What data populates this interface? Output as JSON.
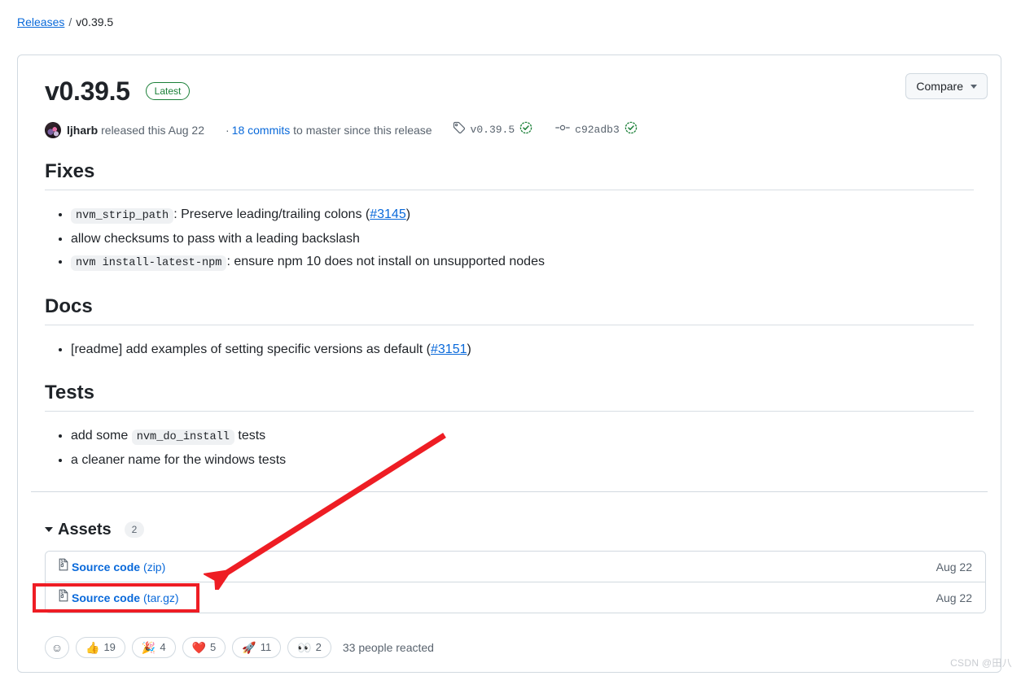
{
  "breadcrumb": {
    "root_label": "Releases",
    "separator": "/",
    "current_label": "v0.39.5"
  },
  "release": {
    "title": "v0.39.5",
    "latest_badge": "Latest",
    "compare_button": "Compare",
    "author": "ljharb",
    "released_text": "released this Aug 22",
    "commits_dot": "·",
    "commits_link": "18 commits",
    "commits_suffix": "to master since this release",
    "tag_name": "v0.39.5",
    "commit_sha": "c92adb3"
  },
  "notes": {
    "sections": [
      {
        "heading": "Fixes",
        "items": [
          {
            "code": "nvm_strip_path",
            "text": ": Preserve leading/trailing colons (",
            "link": "#3145",
            "tail": ")"
          },
          {
            "code": "",
            "text": "allow checksums to pass with a leading backslash",
            "link": "",
            "tail": ""
          },
          {
            "code": "nvm install-latest-npm",
            "text": ": ensure npm 10 does not install on unsupported nodes",
            "link": "",
            "tail": ""
          }
        ]
      },
      {
        "heading": "Docs",
        "items": [
          {
            "code": "",
            "text": "[readme] add examples of setting specific versions as default (",
            "link": "#3151",
            "tail": ")"
          }
        ]
      },
      {
        "heading": "Tests",
        "items": [
          {
            "code": "nvm_do_install",
            "text": "",
            "link": "",
            "tail": "",
            "lead": "add some ",
            "trail": " tests"
          },
          {
            "code": "",
            "text": "a cleaner name for the windows tests",
            "link": "",
            "tail": ""
          }
        ]
      }
    ]
  },
  "assets": {
    "title": "Assets",
    "count": "2",
    "rows": [
      {
        "icon": "file-zip-icon",
        "name": "Source code",
        "ext": "(zip)",
        "date": "Aug 22"
      },
      {
        "icon": "file-zip-icon",
        "name": "Source code",
        "ext": "(tar.gz)",
        "date": "Aug 22"
      }
    ]
  },
  "reactions": {
    "add_label": "☺",
    "pills": [
      {
        "emoji": "👍",
        "count": "19",
        "name": "thumbs-up"
      },
      {
        "emoji": "🎉",
        "count": "4",
        "name": "tada"
      },
      {
        "emoji": "❤️",
        "count": "5",
        "name": "heart"
      },
      {
        "emoji": "🚀",
        "count": "11",
        "name": "rocket"
      },
      {
        "emoji": "👀",
        "count": "2",
        "name": "eyes"
      }
    ],
    "summary": "33 people reacted"
  },
  "watermark": "CSDN @田八",
  "colors": {
    "link": "#0969da",
    "green": "#1a7f37",
    "muted": "#59636e",
    "border": "#d1d9e0",
    "annotation_red": "#ee1d24"
  }
}
